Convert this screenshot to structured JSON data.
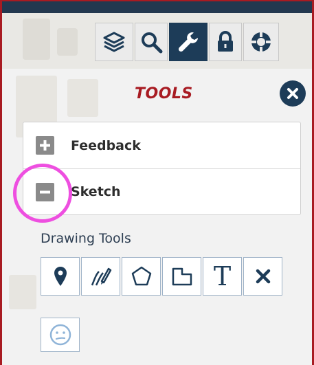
{
  "toolbar": {
    "items": [
      {
        "icon": "layers-icon",
        "active": false
      },
      {
        "icon": "search-icon",
        "active": false
      },
      {
        "icon": "wrench-icon",
        "active": true
      },
      {
        "icon": "lock-icon",
        "active": false
      },
      {
        "icon": "lifebuoy-icon",
        "active": false
      }
    ]
  },
  "panel": {
    "title": "TOOLS",
    "close_icon": "close-icon",
    "sections": [
      {
        "label": "Feedback",
        "icon": "plus-icon",
        "expanded": false
      },
      {
        "label": "Sketch",
        "icon": "minus-icon",
        "expanded": true
      }
    ],
    "drawing_tools_label": "Drawing Tools",
    "drawing_tools": [
      {
        "icon": "marker-icon"
      },
      {
        "icon": "freehand-icon"
      },
      {
        "icon": "polygon-icon"
      },
      {
        "icon": "rectangle-icon"
      },
      {
        "icon": "text-icon",
        "glyph": "T"
      },
      {
        "icon": "delete-icon"
      }
    ],
    "extra_tool_icon": "emoji-icon"
  },
  "colors": {
    "accent": "#a81b22",
    "navy": "#1d3c58",
    "highlight": "#ee4fe0"
  }
}
